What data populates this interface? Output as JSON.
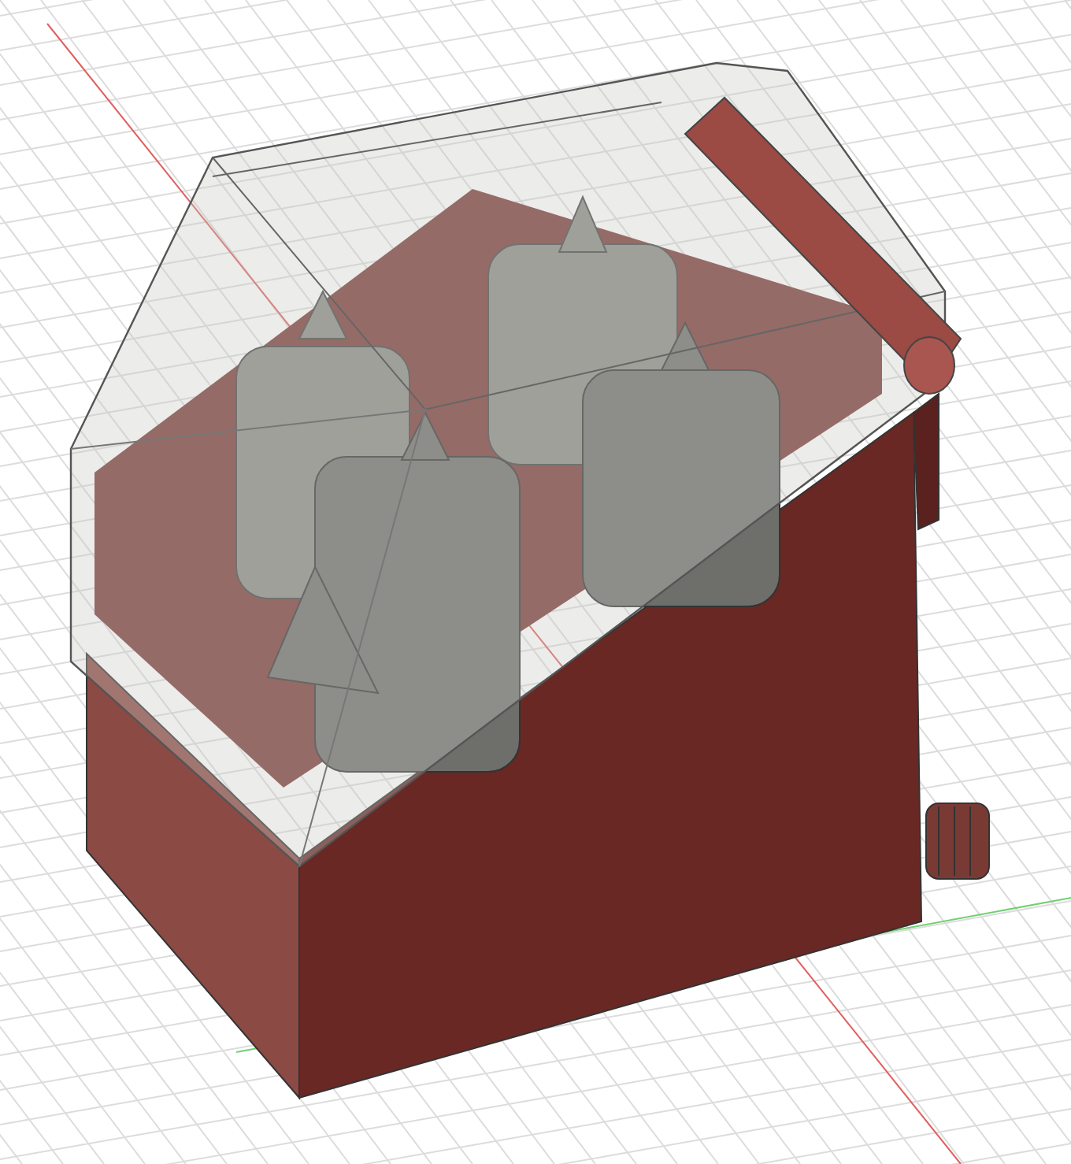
{
  "viewport": {
    "kind": "cad-3d",
    "show_grid": true
  }
}
